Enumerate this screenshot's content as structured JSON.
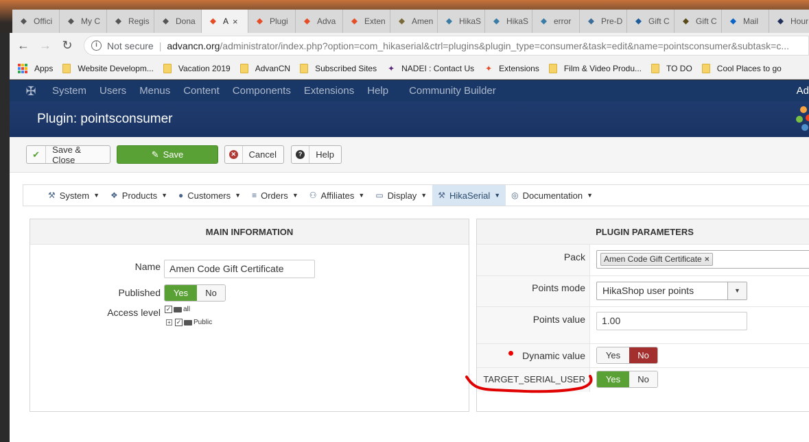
{
  "browser": {
    "tabs": [
      {
        "label": "Offici",
        "icon": "joomla-cross-icon",
        "color": "#555555"
      },
      {
        "label": "My C",
        "icon": "joomla-cross-icon",
        "color": "#555555"
      },
      {
        "label": "Regis",
        "icon": "joomla-cross-icon",
        "color": "#555555"
      },
      {
        "label": "Dona",
        "icon": "joomla-cross-icon",
        "color": "#555555"
      },
      {
        "label": "A",
        "icon": "joomla-logo-icon",
        "color": "#e44d26",
        "active": true
      },
      {
        "label": "Plugi",
        "icon": "joomla-logo-icon",
        "color": "#e44d26"
      },
      {
        "label": "Adva",
        "icon": "joomla-logo-icon",
        "color": "#e44d26"
      },
      {
        "label": "Exten",
        "icon": "joomla-logo-icon",
        "color": "#e44d26"
      },
      {
        "label": "Amen",
        "icon": "amen-icon",
        "color": "#7a6a3a"
      },
      {
        "label": "HikaS",
        "icon": "hikashop-icon",
        "color": "#3a7ca5"
      },
      {
        "label": "HikaS",
        "icon": "hikashop-icon",
        "color": "#3a7ca5"
      },
      {
        "label": "error",
        "icon": "hikashop-icon",
        "color": "#3a7ca5"
      },
      {
        "label": "Pre-D",
        "icon": "wordpress-icon",
        "color": "#3a6d9a"
      },
      {
        "label": "Gift C",
        "icon": "up-logo-icon",
        "color": "#1d5d9b"
      },
      {
        "label": "Gift C",
        "icon": "amen-badge-icon",
        "color": "#5a4a1a"
      },
      {
        "label": "Mail",
        "icon": "outlook-icon",
        "color": "#0a64c8"
      },
      {
        "label": "Hour",
        "icon": "news-icon",
        "color": "#20305a"
      }
    ],
    "close_glyph": "×",
    "address": {
      "security": "Not secure",
      "separator": "|",
      "host": "advancn.org",
      "path": "/administrator/index.php?option=com_hikaserial&ctrl=plugins&plugin_type=consumer&task=edit&name=pointsconsumer&subtask=c..."
    },
    "bookmarks": [
      {
        "label": "Apps",
        "kind": "apps"
      },
      {
        "label": "Website Developm...",
        "kind": "folder"
      },
      {
        "label": "Vacation 2019",
        "kind": "folder"
      },
      {
        "label": "AdvanCN",
        "kind": "folder"
      },
      {
        "label": "Subscribed Sites",
        "kind": "folder"
      },
      {
        "label": "NADEI : Contact Us",
        "kind": "site"
      },
      {
        "label": "Extensions",
        "kind": "joomla"
      },
      {
        "label": "Film & Video Produ...",
        "kind": "folder"
      },
      {
        "label": "TO DO",
        "kind": "folder"
      },
      {
        "label": "Cool Places to go",
        "kind": "folder"
      }
    ]
  },
  "joomla": {
    "menus": [
      "System",
      "Users",
      "Menus",
      "Content",
      "Components",
      "Extensions",
      "Help",
      "Community Builder"
    ],
    "user_short": "Ad",
    "page_title": "Plugin: pointsconsumer",
    "accent": "#1a3867"
  },
  "toolbar": {
    "save_close": "Save & Close",
    "save": "Save",
    "cancel": "Cancel",
    "help": "Help"
  },
  "hikamenu": [
    {
      "label": "System",
      "icon": "wrench-icon"
    },
    {
      "label": "Products",
      "icon": "cubes-icon"
    },
    {
      "label": "Customers",
      "icon": "user-icon"
    },
    {
      "label": "Orders",
      "icon": "list-icon"
    },
    {
      "label": "Affiliates",
      "icon": "users-icon"
    },
    {
      "label": "Display",
      "icon": "monitor-icon"
    },
    {
      "label": "HikaSerial",
      "icon": "wrench-icon",
      "active": true
    },
    {
      "label": "Documentation",
      "icon": "lifebuoy-icon"
    }
  ],
  "main": {
    "heading": "MAIN INFORMATION",
    "name_label": "Name",
    "name_value": "Amen Code Gift Certificate",
    "published_label": "Published",
    "published_yes": "Yes",
    "published_no": "No",
    "access_label": "Access level",
    "tree_all": "all",
    "tree_public": "Public"
  },
  "params": {
    "heading": "PLUGIN PARAMETERS",
    "pack_label": "Pack",
    "pack_token": "Amen Code Gift Certificate",
    "points_mode_label": "Points mode",
    "points_mode_value": "HikaShop user points",
    "points_value_label": "Points value",
    "points_value": "1.00",
    "dynamic_label": "Dynamic value",
    "dynamic_yes": "Yes",
    "dynamic_no": "No",
    "target_label": "TARGET_SERIAL_USER",
    "target_yes": "Yes",
    "target_no": "No"
  },
  "colors": {
    "green": "#5aa135",
    "red": "#a3302f",
    "annotation": "#e00000"
  }
}
